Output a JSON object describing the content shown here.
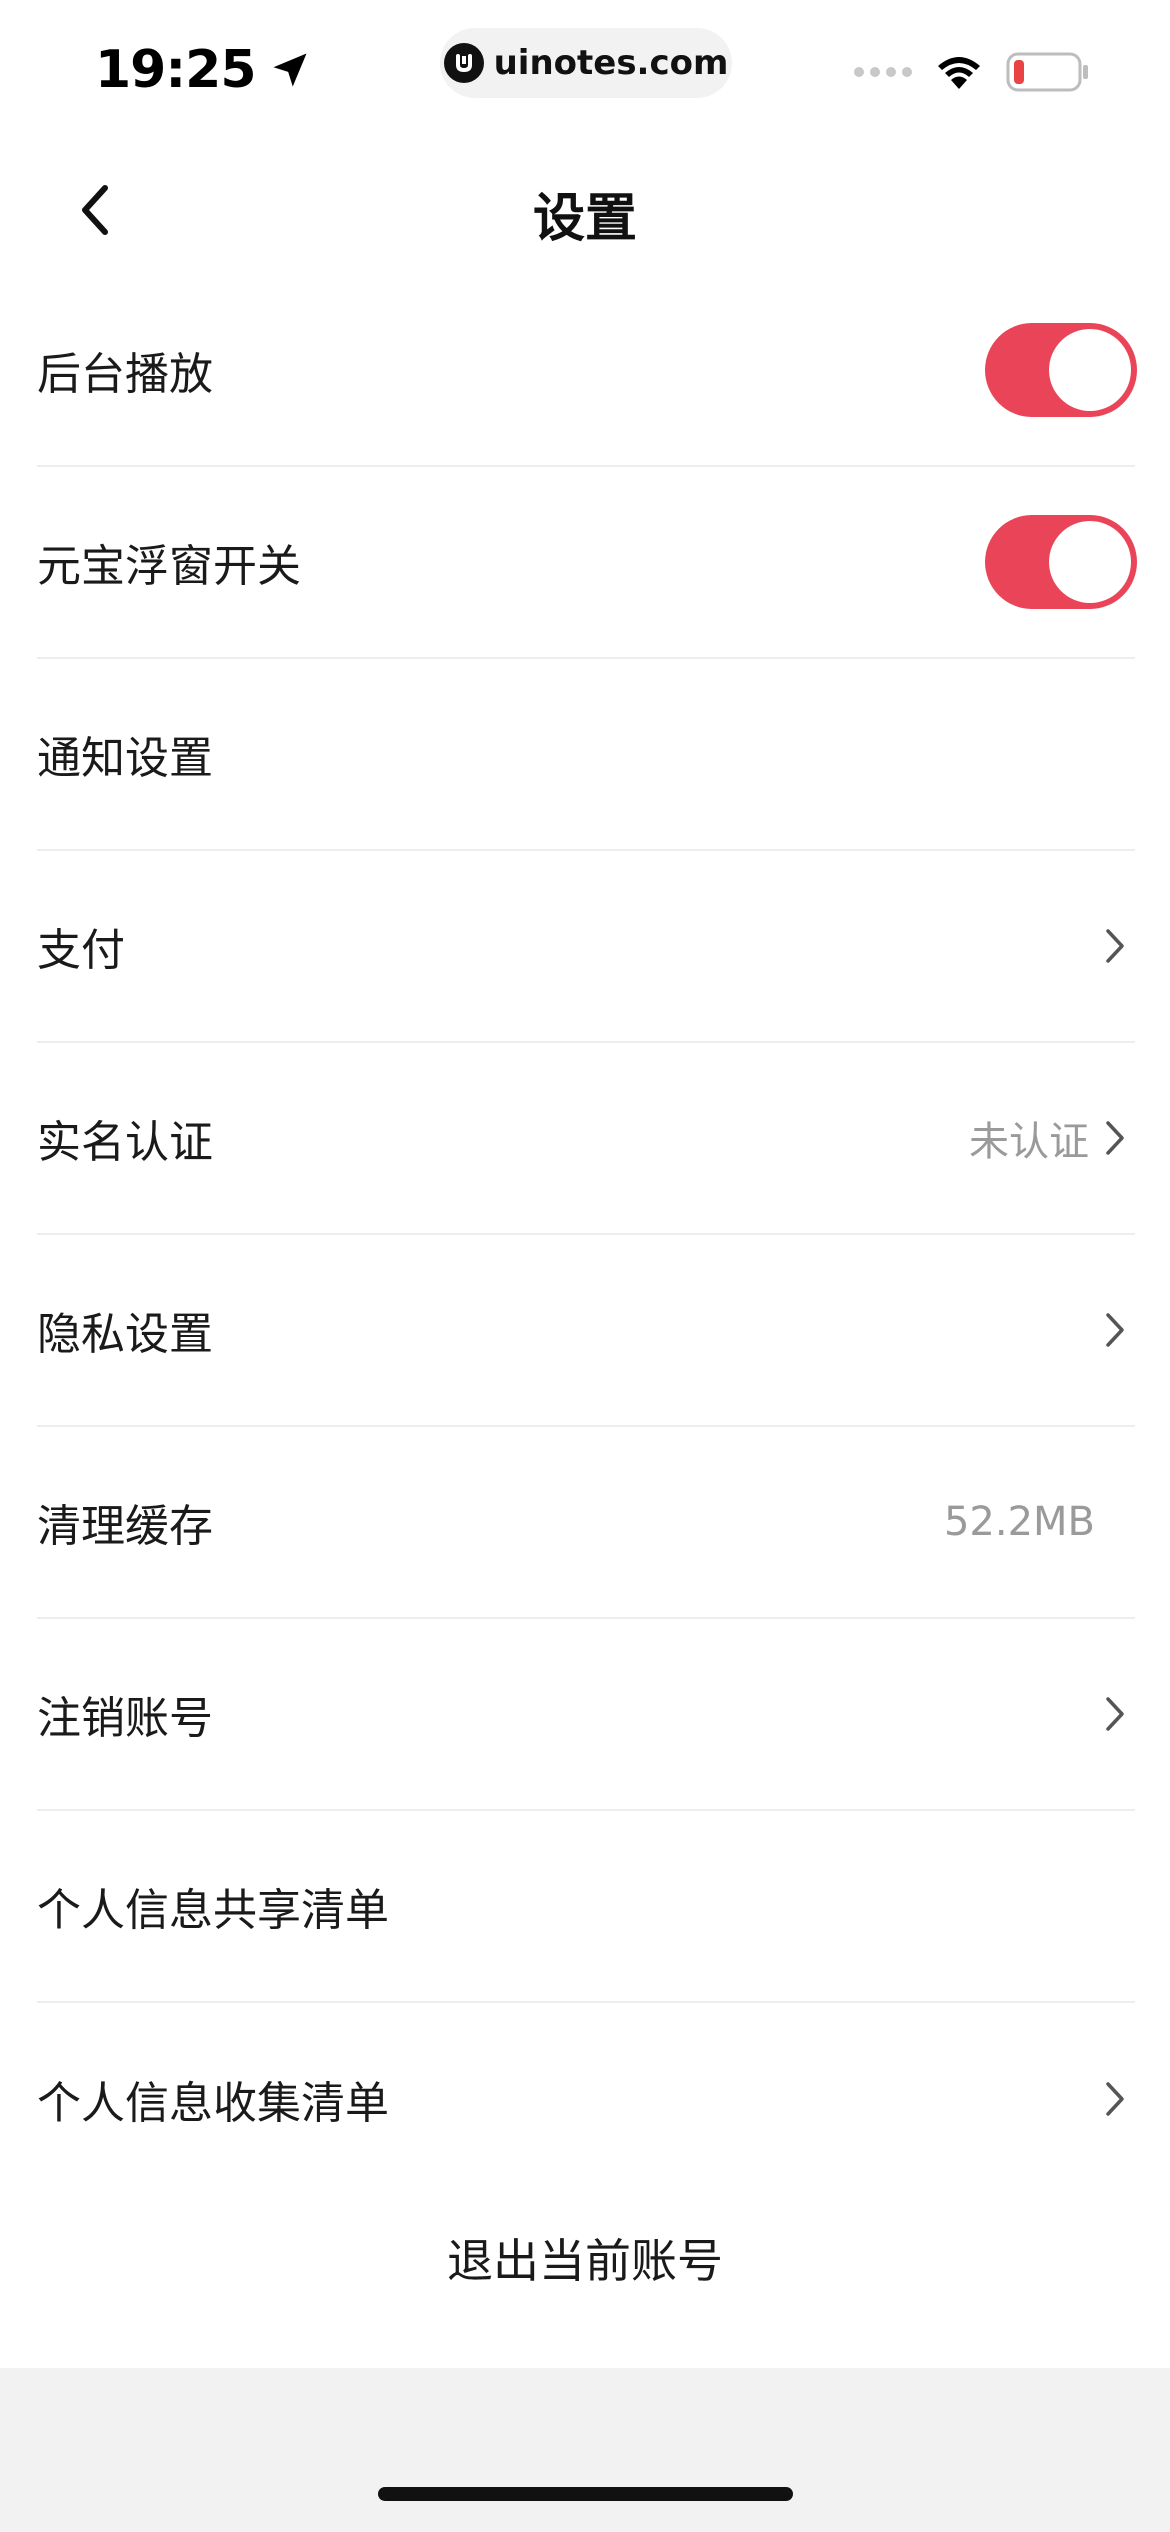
{
  "status_bar": {
    "time": "19:25",
    "url": "uinotes.com"
  },
  "nav": {
    "title": "设置"
  },
  "settings": {
    "background_play": {
      "label": "后台播放",
      "enabled": true
    },
    "yuanbao_float": {
      "label": "元宝浮窗开关",
      "enabled": true
    },
    "notification": {
      "label": "通知设置"
    },
    "payment": {
      "label": "支付"
    },
    "real_name": {
      "label": "实名认证",
      "value": "未认证"
    },
    "privacy": {
      "label": "隐私设置"
    },
    "clear_cache": {
      "label": "清理缓存",
      "value": "52.2MB"
    },
    "delete_account": {
      "label": "注销账号"
    },
    "info_share_list": {
      "label": "个人信息共享清单"
    },
    "info_collect_list": {
      "label": "个人信息收集清单"
    }
  },
  "logout": {
    "label": "退出当前账号"
  },
  "colors": {
    "toggle_on": "#ea4459",
    "battery_low": "#e94343"
  }
}
